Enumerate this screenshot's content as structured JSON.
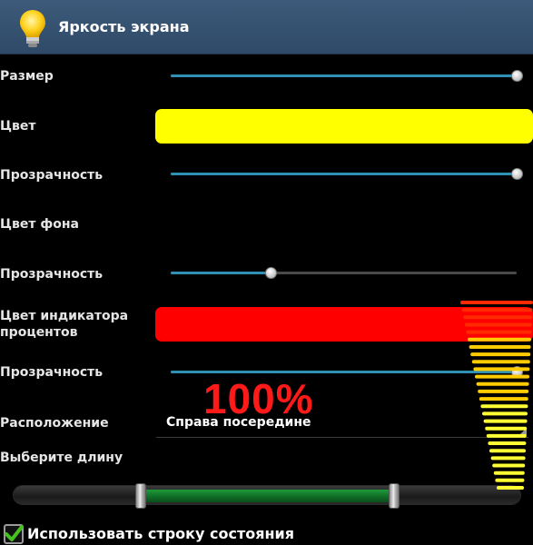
{
  "header": {
    "title": "Яркость экрана",
    "icon": "light-bulb-icon"
  },
  "settings": {
    "size": {
      "label": "Размер",
      "value": 1.0
    },
    "color": {
      "label": "Цвет",
      "value": "#ffff00"
    },
    "opacity1": {
      "label": "Прозрачность",
      "value": 1.0
    },
    "bg_color": {
      "label": "Цвет фона"
    },
    "opacity2": {
      "label": "Прозрачность",
      "value": 0.29
    },
    "indicator_color": {
      "label": "Цвет индикатора процентов",
      "value": "#ff0000"
    },
    "opacity3": {
      "label": "Прозрачность",
      "value": 1.0
    },
    "position": {
      "label": "Расположение",
      "value": "Справа посередине"
    },
    "length": {
      "label": "Выберите длину",
      "range_start": 0.25,
      "range_end": 0.75
    }
  },
  "overlay": {
    "percent": "100%",
    "colors": {
      "top": "#ff2a00",
      "mid": "#ffcc00",
      "bottom": "#ffff33"
    }
  },
  "status_bar": {
    "label": "Использовать строку состояния",
    "checked": true
  },
  "colors": {
    "accent": "#2e91b3",
    "header": "#3a5778",
    "range_fill": "#137a2e"
  }
}
